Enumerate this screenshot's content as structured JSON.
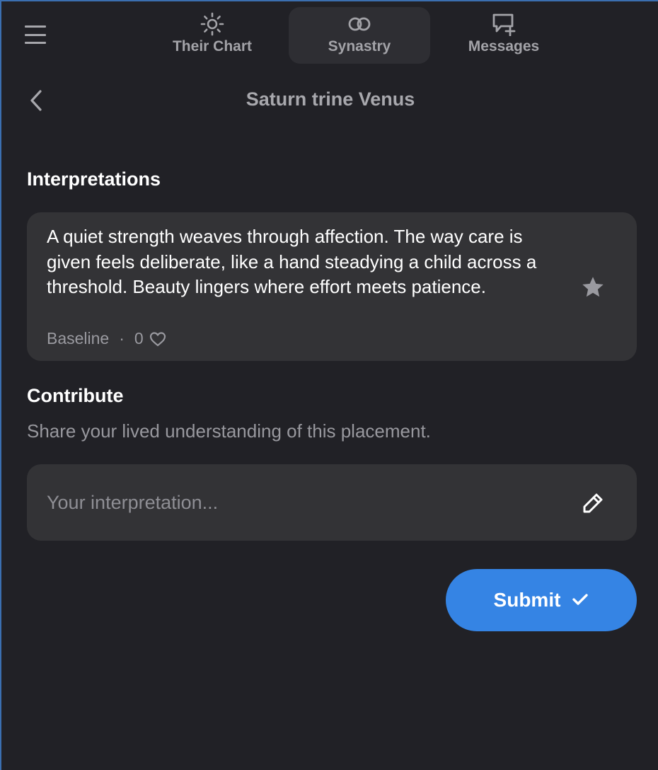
{
  "header": {
    "tabs": [
      {
        "label": "Their Chart",
        "icon": "sun-icon",
        "active": false
      },
      {
        "label": "Synastry",
        "icon": "linked-rings-icon",
        "active": true
      },
      {
        "label": "Messages",
        "icon": "message-plus-icon",
        "active": false
      }
    ]
  },
  "page": {
    "title": "Saturn trine Venus"
  },
  "interpretations": {
    "heading": "Interpretations",
    "items": [
      {
        "text": "A quiet strength weaves through affection. The way care is given feels deliberate, like a hand steadying a child across a threshold. Beauty lingers where effort meets patience.",
        "source": "Baseline",
        "separator": "·",
        "likes": "0"
      }
    ]
  },
  "contribute": {
    "heading": "Contribute",
    "subtext": "Share your lived understanding of this placement.",
    "input_value": "",
    "input_placeholder": "Your interpretation...",
    "submit_label": "Submit"
  },
  "colors": {
    "background": "#212126",
    "card": "#333336",
    "accent": "#3584e4",
    "muted_text": "#a3a3a8"
  }
}
